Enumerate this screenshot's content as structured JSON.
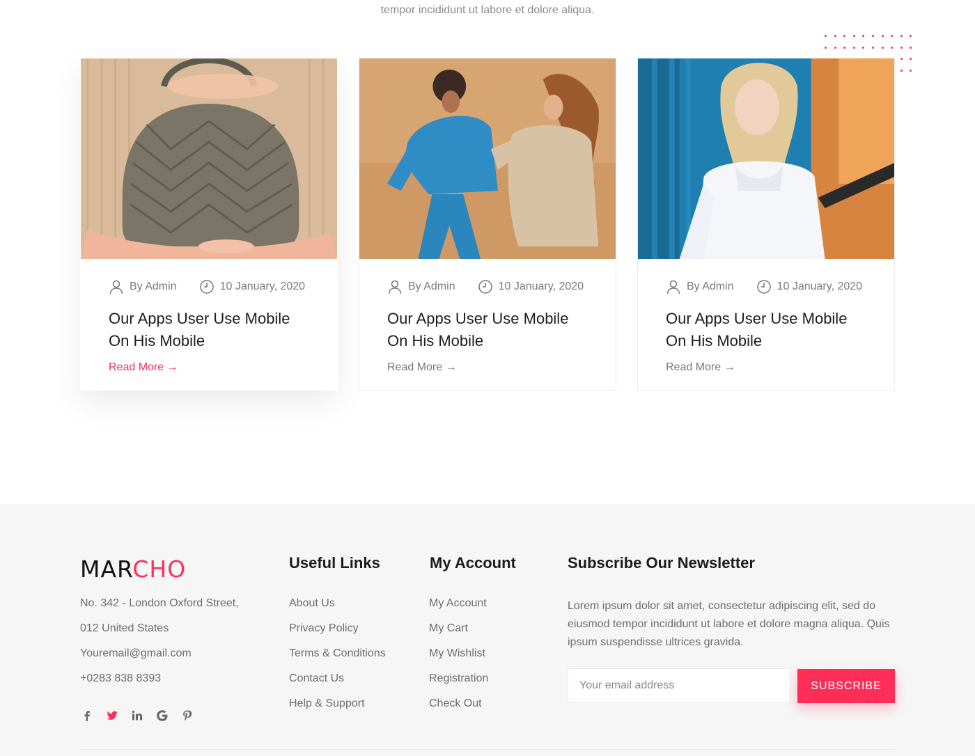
{
  "blog": {
    "intro_text": "tempor incididunt ut labore et dolore aliqua.",
    "posts": [
      {
        "author": "By Admin",
        "date": "10 January, 2020",
        "title": "Our Apps User Use Mobile On His Mobile",
        "read_more": "Read More →",
        "image": "woman holding quilted handbag"
      },
      {
        "author": "By Admin",
        "date": "10 January, 2020",
        "title": "Our Apps User Use Mobile On His Mobile",
        "read_more": "Read More →",
        "image": "two women walking on sand"
      },
      {
        "author": "By Admin",
        "date": "10 January, 2020",
        "title": "Our Apps User Use Mobile On His Mobile",
        "read_more": "Read More →",
        "image": "woman in white ruffled blouse"
      }
    ]
  },
  "footer": {
    "logo": {
      "part1": "MAR",
      "part2": "CHO"
    },
    "address": [
      "No. 342 - London Oxford Street,",
      "012 United States",
      "Youremail@gmail.com",
      "+0283 838 8393"
    ],
    "social": [
      "facebook-icon",
      "twitter-icon",
      "linkedin-icon",
      "google-icon",
      "pinterest-icon"
    ],
    "useful_links": {
      "title": "Useful Links",
      "items": [
        "About Us",
        "Privacy Policy",
        "Terms & Conditions",
        "Contact Us",
        "Help & Support"
      ]
    },
    "my_account": {
      "title": "My Account",
      "items": [
        "My Account",
        "My Cart",
        "My Wishlist",
        "Registration",
        "Check Out"
      ]
    },
    "newsletter": {
      "title": "Subscribe Our Newsletter",
      "text": "Lorem ipsum dolor sit amet, consectetur adipiscing elit, sed do eiusmod tempor incididunt ut labore et dolore magna aliqua. Quis ipsum suspendisse ultrices gravida.",
      "placeholder": "Your email address",
      "button": "SUBSCRIBE"
    }
  },
  "colors": {
    "accent": "#ff2e58",
    "footer_bg": "#f6f6f6",
    "text_muted": "#6d6d6d"
  }
}
